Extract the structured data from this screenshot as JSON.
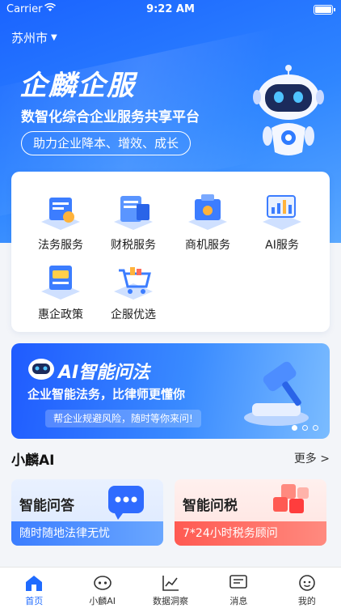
{
  "status": {
    "carrier": "Carrier",
    "time": "9:22 AM"
  },
  "location": {
    "city": "苏州市"
  },
  "hero": {
    "brand": "企麟企服",
    "subtitle": "数智化综合企业服务共享平台",
    "slogan": "助力企业降本、增效、成长"
  },
  "services": [
    {
      "label": "法务服务",
      "icon": "legal-service-icon"
    },
    {
      "label": "财税服务",
      "icon": "finance-tax-icon"
    },
    {
      "label": "商机服务",
      "icon": "business-opportunity-icon"
    },
    {
      "label": "AI服务",
      "icon": "ai-service-icon"
    },
    {
      "label": "惠企政策",
      "icon": "policy-icon"
    },
    {
      "label": "企服优选",
      "icon": "shopping-cart-icon"
    }
  ],
  "banner": {
    "title": "AI智能问法",
    "subtitle": "企业智能法务，比律师更懂你",
    "pill": "帮企业规避风险，随时等你来问!"
  },
  "section": {
    "title": "小麟AI",
    "more": "更多 >"
  },
  "ai_cards": [
    {
      "title": "智能问答",
      "desc": "随时随地法律无忧"
    },
    {
      "title": "智能问税",
      "desc": "7*24小时税务顾问"
    }
  ],
  "next_section_peek": "",
  "tabs": [
    {
      "label": "首页",
      "icon": "home-icon",
      "active": true
    },
    {
      "label": "小麟AI",
      "icon": "robot-icon",
      "active": false
    },
    {
      "label": "数据洞察",
      "icon": "chart-icon",
      "active": false
    },
    {
      "label": "消息",
      "icon": "message-icon",
      "active": false
    },
    {
      "label": "我的",
      "icon": "profile-icon",
      "active": false
    }
  ],
  "colors": {
    "primary": "#1f6bff",
    "red_card": "#ff5a52"
  }
}
